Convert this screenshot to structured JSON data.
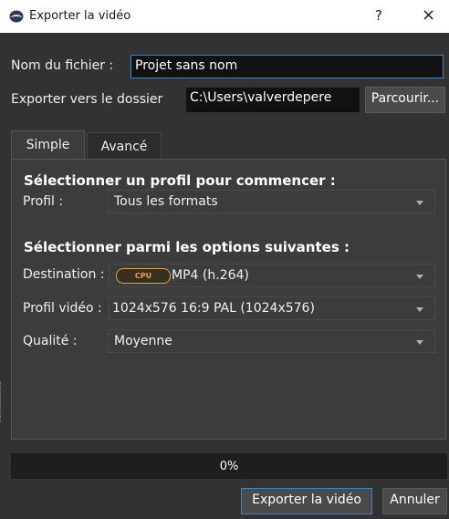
{
  "window": {
    "title": "Exporter la vidéo",
    "help_label": "?",
    "close_label": "×"
  },
  "file": {
    "name_label": "Nom du fichier :",
    "name_value": "Projet sans nom",
    "folder_label": "Exporter vers le dossier",
    "folder_value": "C:\\Users\\valverdepere",
    "browse_label": "Parcourir..."
  },
  "tabs": [
    {
      "label": "Simple",
      "active": true
    },
    {
      "label": "Avancé",
      "active": false
    }
  ],
  "simple": {
    "profile_heading": "Sélectionner un profil pour commencer :",
    "profile_label": "Profil :",
    "profile_value": "Tous les formats",
    "options_heading": "Sélectionner parmi les options suivantes :",
    "destination_label": "Destination :",
    "destination_badge": "CPU",
    "destination_value": "MP4 (h.264)",
    "video_profile_label": "Profil vidéo :",
    "video_profile_value": "1024x576 16:9 PAL (1024x576)",
    "quality_label": "Qualité :",
    "quality_value": "Moyenne"
  },
  "progress": {
    "value": 0,
    "label": "0%"
  },
  "actions": {
    "export_label": "Exporter la vidéo",
    "cancel_label": "Annuler"
  },
  "colors": {
    "background": "#323232",
    "accent": "#3d84c6",
    "cpu_badge": "#e0a24a"
  }
}
